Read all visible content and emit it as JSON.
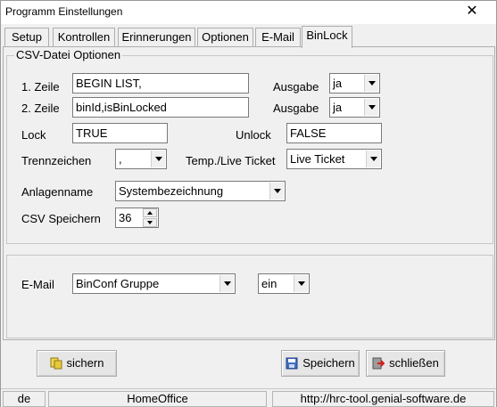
{
  "window": {
    "title": "Programm Einstellungen"
  },
  "tabs": [
    "Setup",
    "Kontrollen",
    "Erinnerungen",
    "Optionen",
    "E-Mail",
    "BinLock"
  ],
  "csv": {
    "group_title": "CSV-Datei Optionen",
    "zeile1_label": "1. Zeile",
    "zeile1_value": "BEGIN LIST,",
    "zeile2_label": "2. Zeile",
    "zeile2_value": "binId,isBinLocked",
    "ausgabe_label": "Ausgabe",
    "ausgabe1_value": "ja",
    "ausgabe2_value": "ja",
    "lock_label": "Lock",
    "lock_value": "TRUE",
    "unlock_label": "Unlock",
    "unlock_value": "FALSE",
    "trennzeichen_label": "Trennzeichen",
    "trennzeichen_value": ",",
    "ticket_label": "Temp./Live Ticket",
    "ticket_value": "Live Ticket",
    "anlagenname_label": "Anlagenname",
    "anlagenname_value": "Systembezeichnung",
    "speichern_label": "CSV Speichern",
    "speichern_value": "36"
  },
  "email": {
    "label": "E-Mail",
    "group_value": "BinConf Gruppe",
    "state_value": "ein"
  },
  "buttons": {
    "sichern": "sichern",
    "speichern": "Speichern",
    "schliessen": "schließen"
  },
  "status": {
    "lang": "de",
    "location": "HomeOffice",
    "url": "http://hrc-tool.genial-software.de"
  },
  "icons": {
    "sichern": "backup-icon",
    "speichern": "floppy-disk-icon",
    "schliessen": "exit-door-icon"
  }
}
